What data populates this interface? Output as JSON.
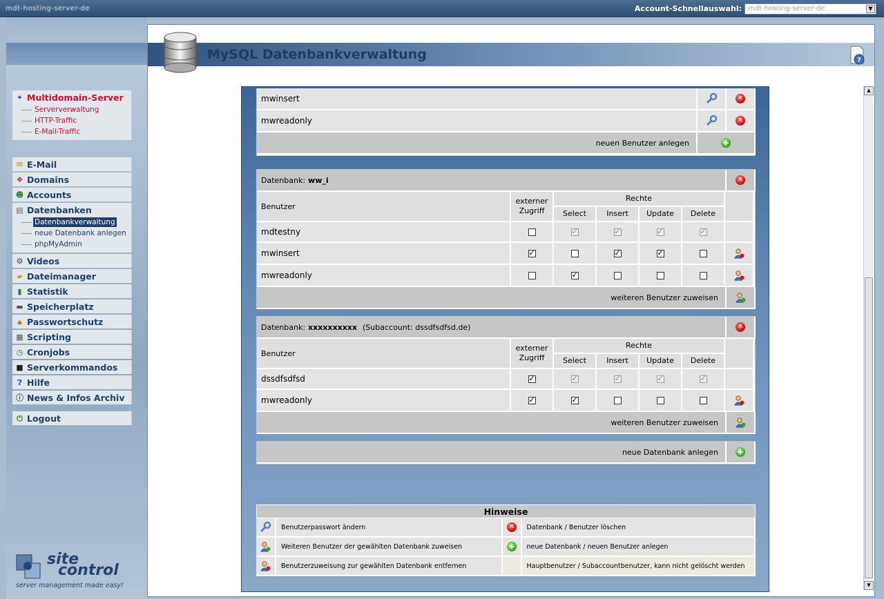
{
  "topbar": {
    "host": "mdt-hosting-server-de",
    "quick_select_label": "Account-Schnellauswahl:",
    "quick_select_value": "mdt-hosting-server-de"
  },
  "sidebar": {
    "server": {
      "label": "Multidomain-Server",
      "items": [
        "Serververwaltung",
        "HTTP-Traffic",
        "E-Mail-Traffic"
      ]
    },
    "sections": [
      {
        "label": "E-Mail",
        "icon": "mail-icon"
      },
      {
        "label": "Domains",
        "icon": "domains-icon"
      },
      {
        "label": "Accounts",
        "icon": "accounts-icon"
      },
      {
        "label": "Datenbanken",
        "icon": "database-icon"
      },
      {
        "label": "Videos",
        "icon": "video-icon"
      },
      {
        "label": "Dateimanager",
        "icon": "folder-icon"
      },
      {
        "label": "Statistik",
        "icon": "stats-icon"
      },
      {
        "label": "Speicherplatz",
        "icon": "disk-icon"
      },
      {
        "label": "Passwortschutz",
        "icon": "lock-icon"
      },
      {
        "label": "Scripting",
        "icon": "script-icon"
      },
      {
        "label": "Cronjobs",
        "icon": "clock-icon"
      },
      {
        "label": "Serverkommandos",
        "icon": "terminal-icon"
      },
      {
        "label": "Hilfe",
        "icon": "help-icon"
      },
      {
        "label": "News & Infos Archiv",
        "icon": "info-icon"
      },
      {
        "label": "Logout",
        "icon": "logout-icon"
      }
    ],
    "db_items": [
      "Datenbankverwaltung",
      "neue Datenbank anlegen",
      "phpMyAdmin"
    ]
  },
  "logo": {
    "line1": "site",
    "line2": "control",
    "tagline": "server management made easy!"
  },
  "page": {
    "title": "MySQL Datenbankverwaltung"
  },
  "users_block": {
    "users": [
      "mwinsert",
      "mwreadonly"
    ],
    "new_user": "neuen Benutzer anlegen"
  },
  "labels": {
    "db_prefix": "Datenbank:",
    "user_col": "Benutzer",
    "ext_access": "externer Zugriff",
    "rights": "Rechte",
    "select": "Select",
    "insert": "Insert",
    "update": "Update",
    "delete": "Delete",
    "assign_user": "weiteren Benutzer zuweisen",
    "new_db": "neue Datenbank anlegen"
  },
  "databases": [
    {
      "name": "ww_i",
      "subaccount": "",
      "rows": [
        {
          "user": "mdtestny",
          "ext": false,
          "s": true,
          "i": true,
          "u": true,
          "d": true,
          "disabled": true
        },
        {
          "user": "mwinsert",
          "ext": true,
          "s": false,
          "i": true,
          "u": true,
          "d": false,
          "disabled": false
        },
        {
          "user": "mwreadonly",
          "ext": false,
          "s": true,
          "i": false,
          "u": false,
          "d": false,
          "disabled": false
        }
      ]
    },
    {
      "name": "xxxxxxxxxx",
      "subaccount": "(Subaccount: dssdfsdfsd.de)",
      "rows": [
        {
          "user": "dssdfsdfsd",
          "ext": true,
          "s": true,
          "i": true,
          "u": true,
          "d": true,
          "disabled": true
        },
        {
          "user": "mwreadonly",
          "ext": true,
          "s": true,
          "i": false,
          "u": false,
          "d": false,
          "disabled": false
        }
      ]
    }
  ],
  "hints": {
    "title": "Hinweise",
    "rows": [
      {
        "left": "Benutzerpasswort ändern",
        "right": "Datenbank / Benutzer löschen"
      },
      {
        "left": "Weiteren Benutzer der gewählten Datenbank zuweisen",
        "right": "neue Datenbank / neuen Benutzer anlegen"
      },
      {
        "left": "Benutzerzuweisung zur gewählten Datenbank entfernen",
        "right": "Hauptbenutzer / Subaccountbenutzer, kann nicht gelöscht werden"
      }
    ]
  }
}
